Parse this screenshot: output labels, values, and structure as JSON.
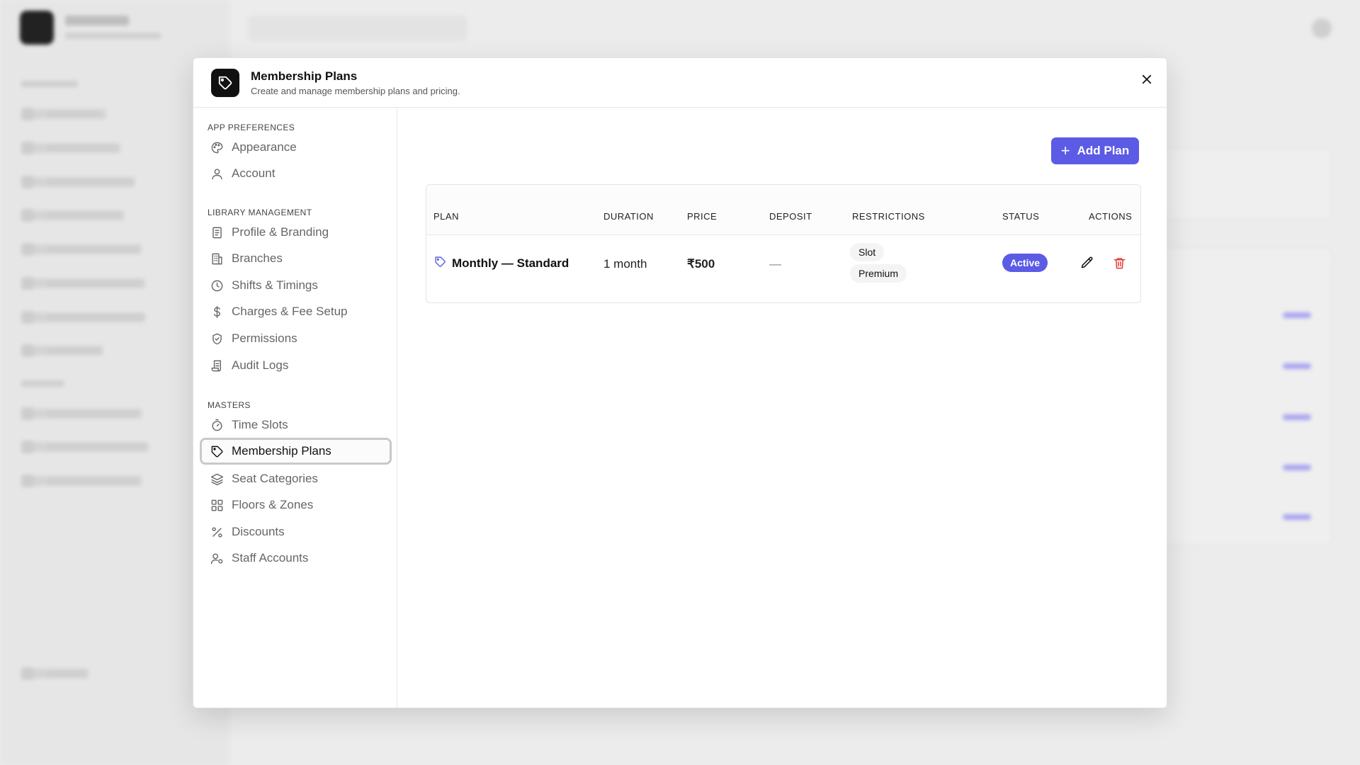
{
  "modal": {
    "title": "Membership Plans",
    "subtitle": "Create and manage membership plans and pricing.",
    "header_icon": "tag-icon",
    "close_icon": "close-icon"
  },
  "nav": {
    "sections": [
      {
        "title": "APP PREFERENCES",
        "items": [
          {
            "label": "Appearance",
            "icon": "palette-icon"
          },
          {
            "label": "Account",
            "icon": "user-icon"
          }
        ]
      },
      {
        "title": "LIBRARY MANAGEMENT",
        "items": [
          {
            "label": "Profile & Branding",
            "icon": "document-icon"
          },
          {
            "label": "Branches",
            "icon": "building-icon"
          },
          {
            "label": "Shifts & Timings",
            "icon": "clock-icon"
          },
          {
            "label": "Charges & Fee Setup",
            "icon": "dollar-icon"
          },
          {
            "label": "Permissions",
            "icon": "shield-icon"
          },
          {
            "label": "Audit Logs",
            "icon": "scroll-icon"
          }
        ]
      },
      {
        "title": "MASTERS",
        "items": [
          {
            "label": "Time Slots",
            "icon": "timer-icon"
          },
          {
            "label": "Membership Plans",
            "icon": "tag-icon",
            "active": true
          },
          {
            "label": "Seat Categories",
            "icon": "layers-icon"
          },
          {
            "label": "Floors & Zones",
            "icon": "grid-icon"
          },
          {
            "label": "Discounts",
            "icon": "percent-icon"
          },
          {
            "label": "Staff Accounts",
            "icon": "user-cog-icon"
          }
        ]
      }
    ]
  },
  "toolbar": {
    "add_label": "Add Plan"
  },
  "table": {
    "columns": [
      "PLAN",
      "DURATION",
      "PRICE",
      "DEPOSIT",
      "RESTRICTIONS",
      "STATUS",
      "ACTIONS"
    ],
    "rows": [
      {
        "plan": "Monthly — Standard",
        "duration": "1 month",
        "price": "₹500",
        "deposit": "—",
        "restrictions": [
          "Slot",
          "Premium"
        ],
        "status": "Active"
      }
    ]
  },
  "colors": {
    "accent": "#5b5be6",
    "danger": "#e53935",
    "text": "#111111"
  }
}
